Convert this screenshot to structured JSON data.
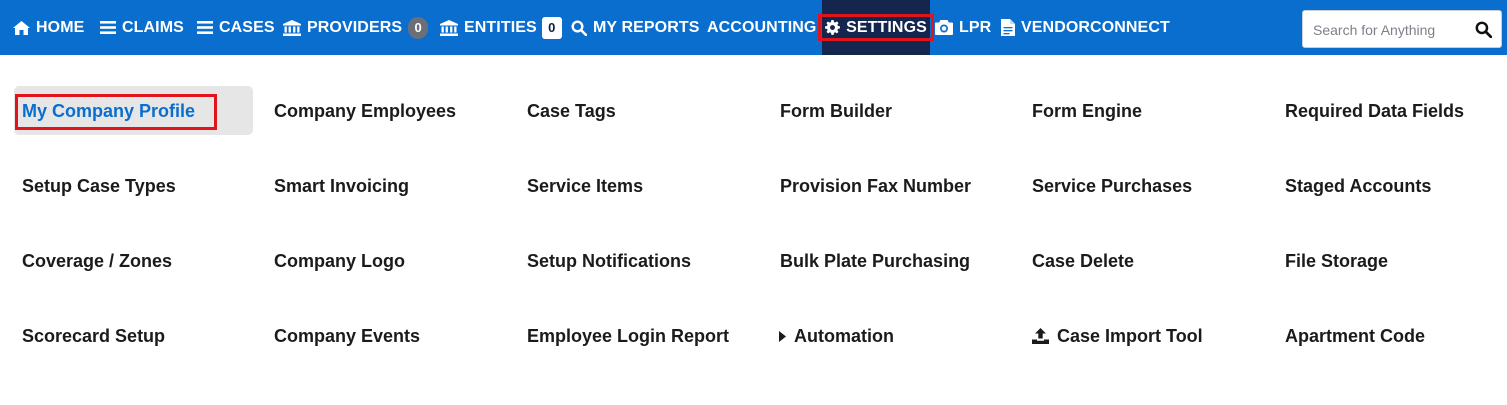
{
  "nav": {
    "home": "HOME",
    "claims": "CLAIMS",
    "cases": "CASES",
    "providers": "PROVIDERS",
    "providers_count": "0",
    "entities": "ENTITIES",
    "entities_count": "0",
    "my_reports": "MY REPORTS",
    "accounting": "ACCOUNTING",
    "settings": "SETTINGS",
    "lpr": "LPR",
    "vendorconnect": "VENDORCONNECT",
    "search_placeholder": "Search for Anything",
    "search_value": "",
    "icons": {
      "home": "home-icon",
      "claims": "menu-lines-icon",
      "cases": "menu-lines-icon",
      "providers": "bank-icon",
      "entities": "bank-icon",
      "my_reports": "search-icon",
      "settings": "gear-icon",
      "lpr": "camera-icon",
      "vendorconnect": "document-icon",
      "search": "search-icon"
    }
  },
  "settings": {
    "active_item": "My Company Profile",
    "rows": [
      [
        "My Company Profile",
        "Company Employees",
        "Case Tags",
        "Form Builder",
        "Form Engine",
        "Required Data Fields"
      ],
      [
        "Setup Case Types",
        "Smart Invoicing",
        "Service Items",
        "Provision Fax Number",
        "Service Purchases",
        "Staged Accounts"
      ],
      [
        "Coverage / Zones",
        "Company Logo",
        "Setup Notifications",
        "Bulk Plate Purchasing",
        "Case Delete",
        "File Storage"
      ],
      [
        "Scorecard Setup",
        "Company Events",
        "Employee Login Report",
        "Automation",
        "Case Import Tool",
        "Apartment Code"
      ]
    ],
    "icons": {
      "automation": "caret-right-icon",
      "case_import_tool": "upload-icon"
    }
  },
  "colors": {
    "nav_bg": "#0a6ecf",
    "nav_active_bg": "#14264e",
    "highlight": "#e0141d",
    "link_active": "#0a6ecf"
  }
}
